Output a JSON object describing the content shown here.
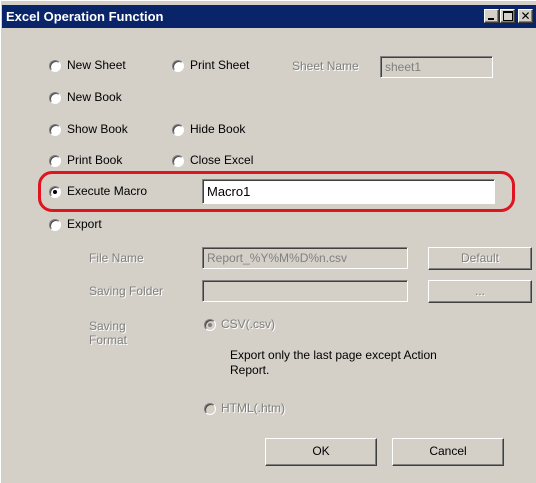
{
  "window": {
    "title": "Excel Operation Function"
  },
  "options": {
    "new_sheet": "New Sheet",
    "print_sheet": "Print Sheet",
    "sheet_name_label": "Sheet Name",
    "sheet_name_value": "sheet1",
    "new_book": "New Book",
    "show_book": "Show Book",
    "hide_book": "Hide Book",
    "print_book": "Print Book",
    "close_excel": "Close Excel",
    "execute_macro": "Execute Macro",
    "macro_value": "Macro1",
    "export": "Export"
  },
  "export_settings": {
    "file_name_label": "File Name",
    "file_name_value": "Report_%Y%M%D%n.csv",
    "default_button": "Default",
    "saving_folder_label": "Saving Folder",
    "saving_folder_value": "",
    "browse_button": "...",
    "saving_format_label_1": "Saving",
    "saving_format_label_2": "Format",
    "csv_option": "CSV(.csv)",
    "csv_note_1": "Export only the last page except Action",
    "csv_note_2": "Report.",
    "html_option": "HTML(.htm)"
  },
  "buttons": {
    "ok": "OK",
    "cancel": "Cancel"
  },
  "selected_option": "execute_macro",
  "highlight_color": "#e0141e"
}
